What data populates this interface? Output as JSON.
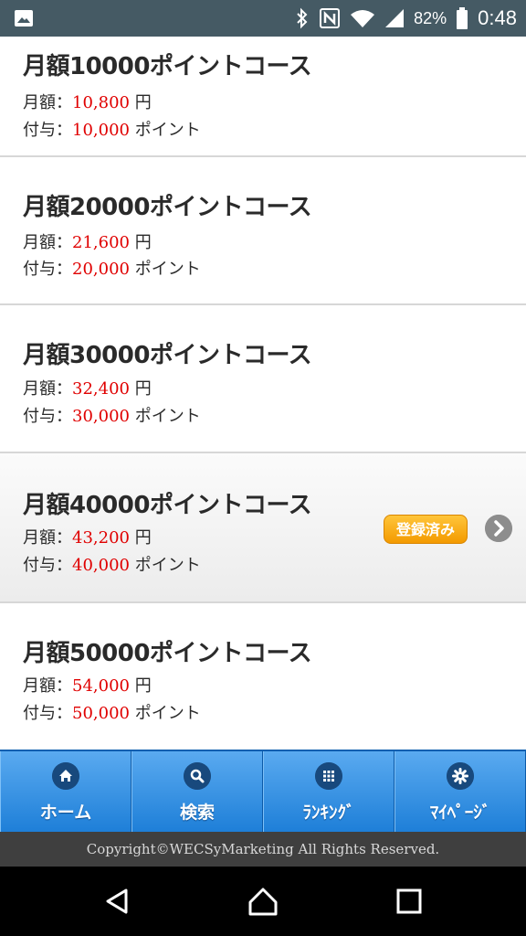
{
  "status_bar": {
    "battery_percent": "82%",
    "time": "0:48",
    "icons": [
      "image-icon",
      "bluetooth-icon",
      "nfc-icon",
      "wifi-icon",
      "signal-icon",
      "battery-icon"
    ]
  },
  "courses": [
    {
      "title": "月額10000ポイントコース",
      "price_label": "月額：",
      "price": "10,800",
      "price_unit": "円",
      "points_label": "付与：",
      "points": "10,000",
      "points_unit": "ポイント"
    },
    {
      "title": "月額20000ポイントコース",
      "price_label": "月額：",
      "price": "21,600",
      "price_unit": "円",
      "points_label": "付与：",
      "points": "20,000",
      "points_unit": "ポイント"
    },
    {
      "title": "月額30000ポイントコース",
      "price_label": "月額：",
      "price": "32,400",
      "price_unit": "円",
      "points_label": "付与：",
      "points": "30,000",
      "points_unit": "ポイント"
    },
    {
      "title": "月額40000ポイントコース",
      "price_label": "月額：",
      "price": "43,200",
      "price_unit": "円",
      "points_label": "付与：",
      "points": "40,000",
      "points_unit": "ポイント",
      "badge": "登録済み"
    },
    {
      "title": "月額50000ポイントコース",
      "price_label": "月額：",
      "price": "54,000",
      "price_unit": "円",
      "points_label": "付与：",
      "points": "50,000",
      "points_unit": "ポイント"
    }
  ],
  "nav": [
    {
      "label": "ホーム",
      "icon": "home-icon"
    },
    {
      "label": "検索",
      "icon": "search-icon"
    },
    {
      "label": "ﾗﾝｷﾝｸﾞ",
      "icon": "grid-icon"
    },
    {
      "label": "ﾏｲﾍﾟｰｼﾞ",
      "icon": "gear-icon"
    }
  ],
  "footer": {
    "copyright": "Copyright©WECSyMarketing All Rights Reserved."
  },
  "colors": {
    "accent_red": "#e00000",
    "nav_blue": "#1e7fd8",
    "badge_orange": "#f7a81b",
    "status_bar": "#455a64"
  }
}
